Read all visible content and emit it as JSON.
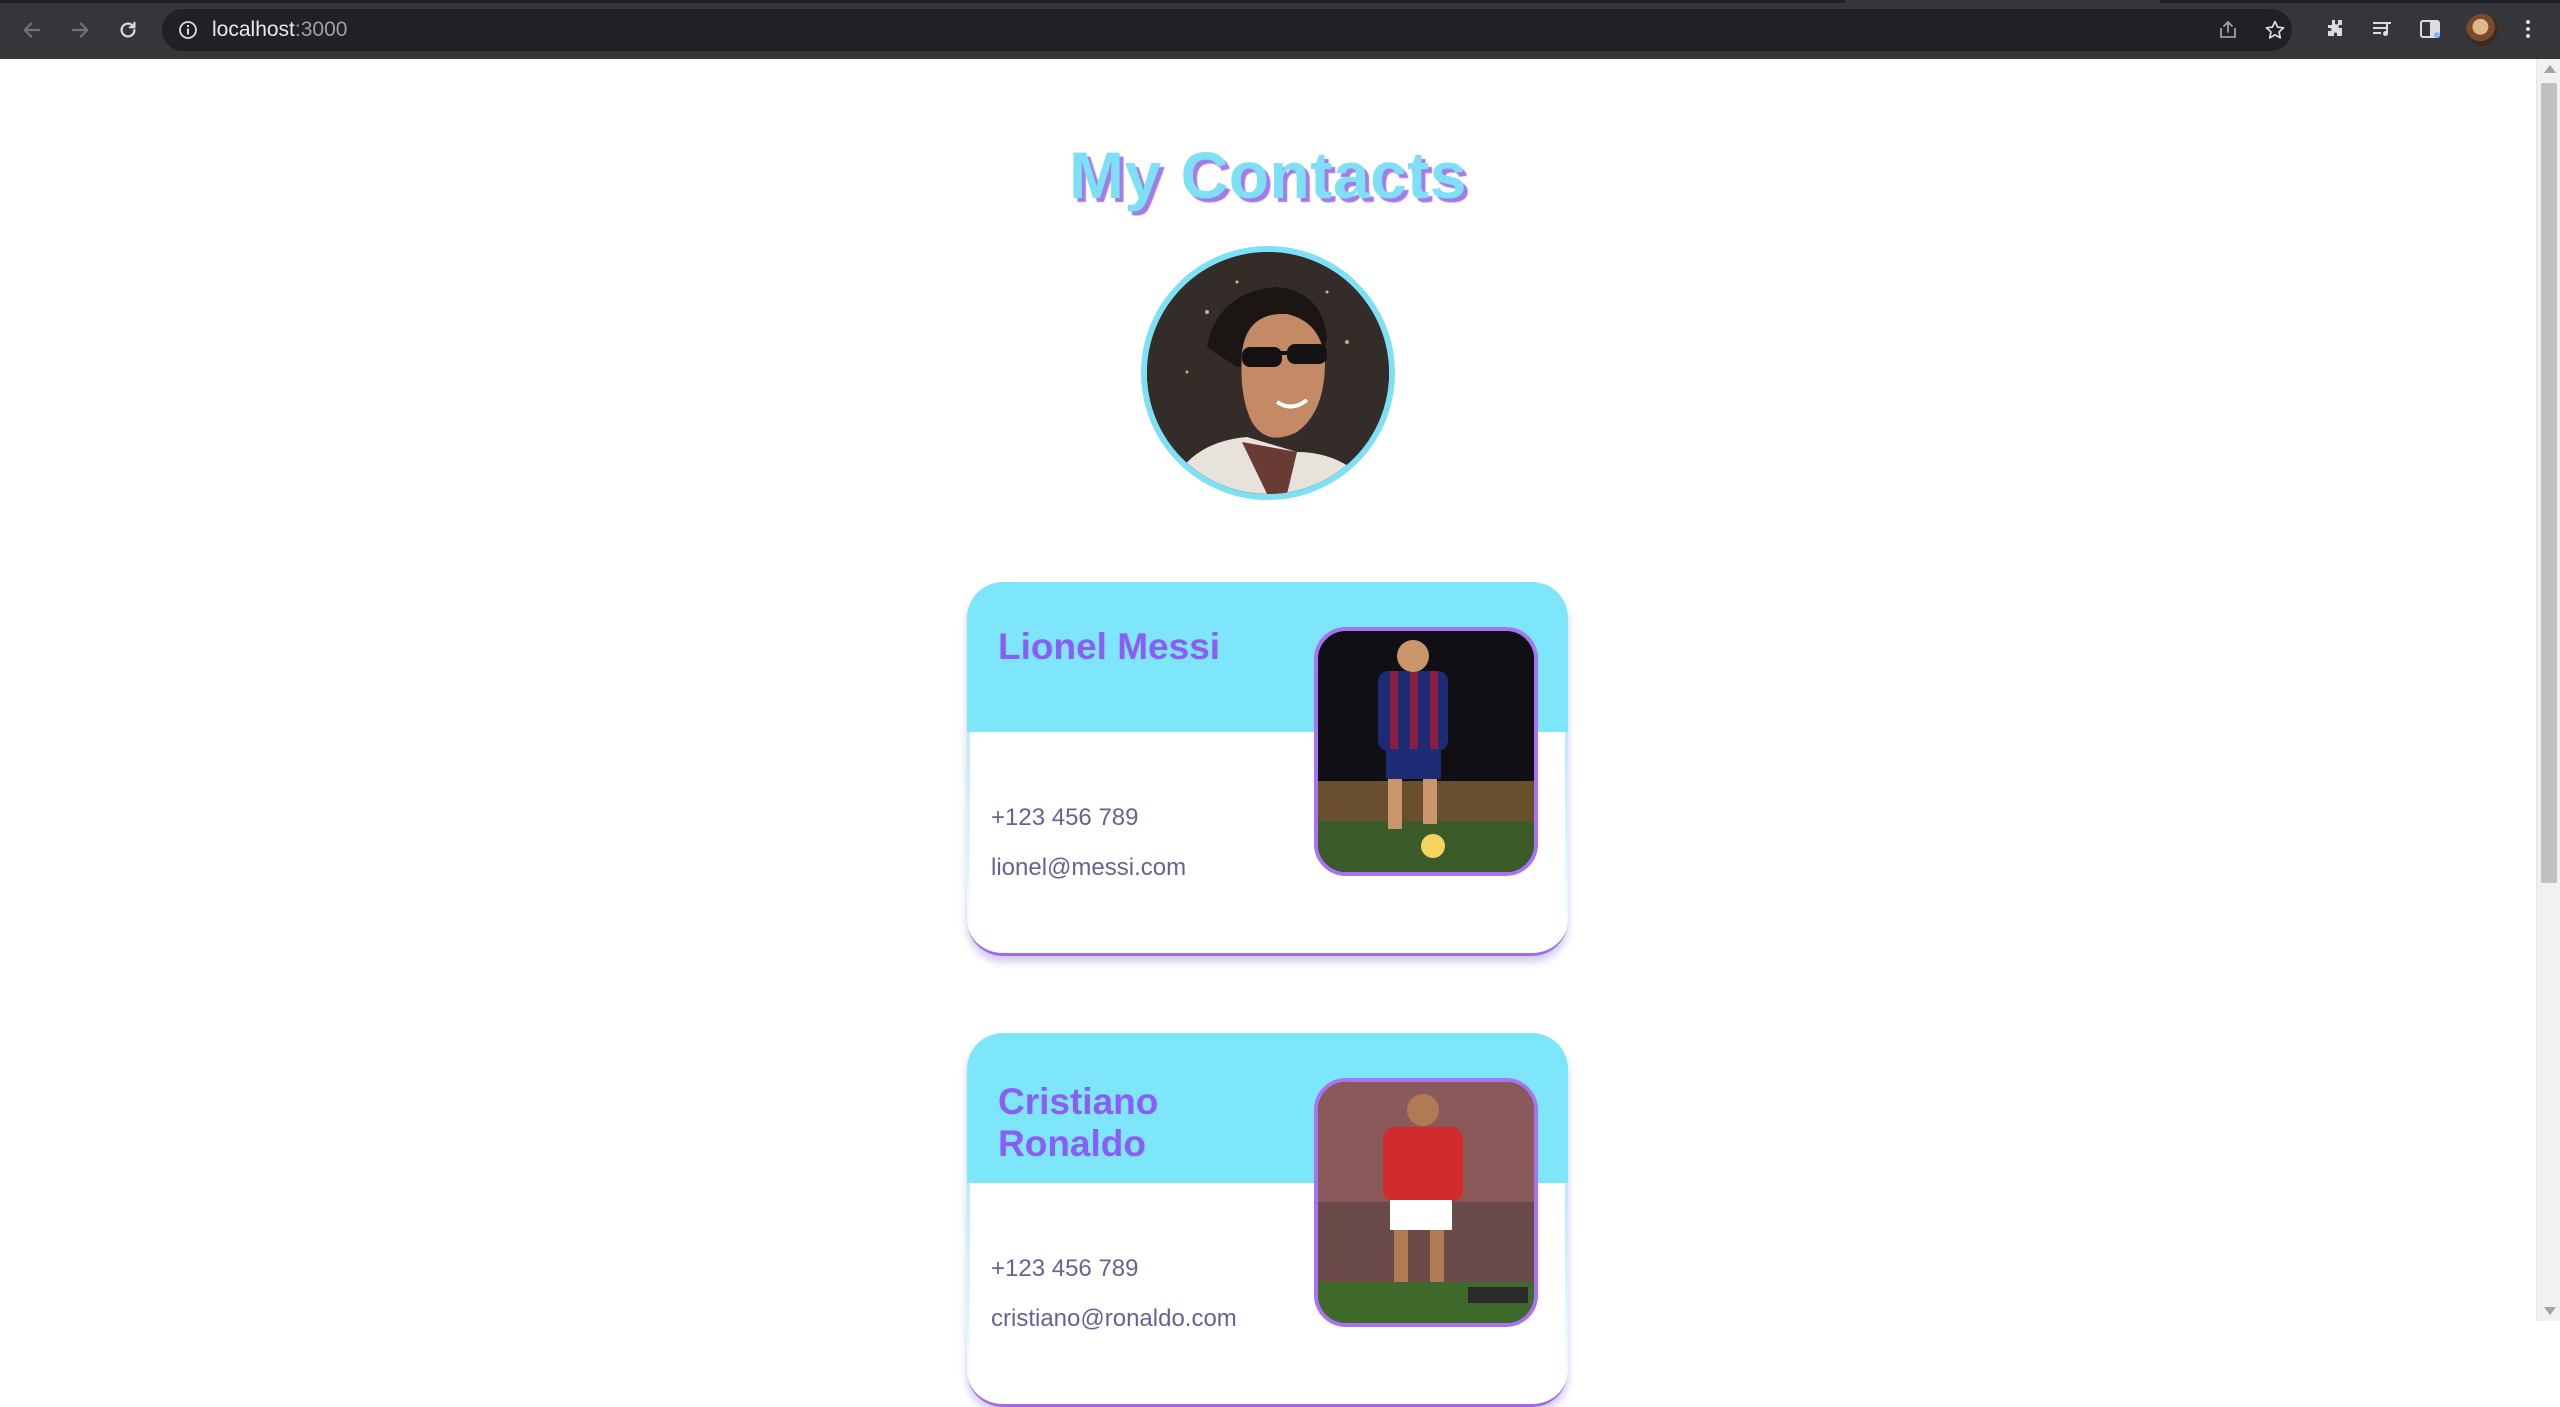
{
  "browser": {
    "url_host": "localhost",
    "url_port": ":3000",
    "icons": {
      "back": "arrow-left-icon",
      "forward": "arrow-right-icon",
      "reload": "reload-icon",
      "site_info": "info-icon",
      "share": "share-icon",
      "bookmark": "star-icon",
      "extensions": "puzzle-icon",
      "media": "playlist-icon",
      "side_panel": "side-panel-icon",
      "menu": "kebab-menu-icon"
    }
  },
  "page": {
    "title": "My Contacts",
    "colors": {
      "accent_cyan": "#7de6fa",
      "accent_purple": "#8b5cf6",
      "text_muted": "#6b5f95"
    }
  },
  "contacts": [
    {
      "name": "Lionel Messi",
      "phone": "+123 456 789",
      "email": "lionel@messi.com",
      "kit_colors": [
        "#1c2b73",
        "#8b1e3f"
      ]
    },
    {
      "name": "Cristiano Ronaldo",
      "phone": "+123 456 789",
      "email": "cristiano@ronaldo.com",
      "kit_colors": [
        "#d22b2b",
        "#ffffff"
      ]
    }
  ]
}
